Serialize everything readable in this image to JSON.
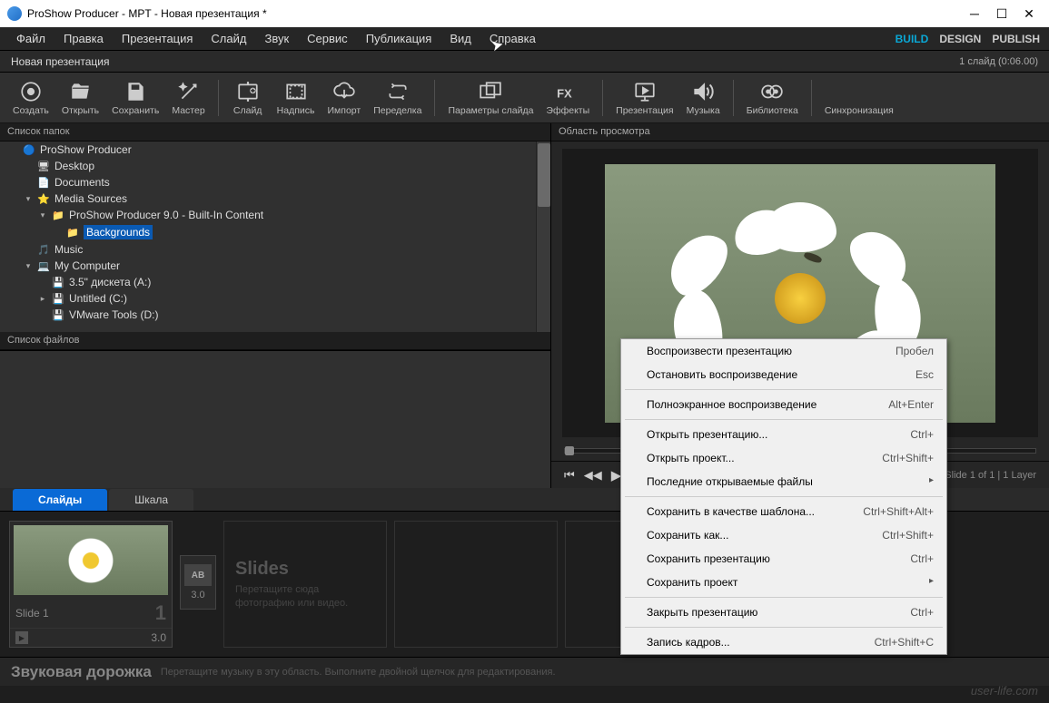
{
  "window": {
    "title": "ProShow Producer - MPT - Новая презентация *"
  },
  "menu": [
    "Файл",
    "Правка",
    "Презентация",
    "Слайд",
    "Звук",
    "Сервис",
    "Публикация",
    "Вид",
    "Справка"
  ],
  "modes": {
    "build": "BUILD",
    "design": "DESIGN",
    "publish": "PUBLISH"
  },
  "subtitle": {
    "left": "Новая презентация",
    "right": "1 слайд (0:06.00)"
  },
  "toolbar": [
    {
      "id": "create",
      "label": "Создать"
    },
    {
      "id": "open",
      "label": "Открыть"
    },
    {
      "id": "save",
      "label": "Сохранить"
    },
    {
      "id": "wizard",
      "label": "Мастер"
    },
    {
      "sep": true
    },
    {
      "id": "slide",
      "label": "Слайд"
    },
    {
      "id": "caption",
      "label": "Надпись"
    },
    {
      "id": "import",
      "label": "Импорт"
    },
    {
      "id": "remix",
      "label": "Переделка"
    },
    {
      "sep": true
    },
    {
      "id": "slide-params",
      "label": "Параметры слайда"
    },
    {
      "id": "effects",
      "label": "Эффекты"
    },
    {
      "sep": true
    },
    {
      "id": "presentation",
      "label": "Презентация"
    },
    {
      "id": "music",
      "label": "Музыка"
    },
    {
      "sep": true
    },
    {
      "id": "library",
      "label": "Библиотека"
    },
    {
      "sep": true
    },
    {
      "id": "sync",
      "label": "Синхронизация"
    }
  ],
  "panes": {
    "folders": "Список папок",
    "files": "Список файлов",
    "preview": "Область просмотра"
  },
  "tree": [
    {
      "indent": 0,
      "icon": "app",
      "label": "ProShow Producer",
      "expand": ""
    },
    {
      "indent": 1,
      "icon": "desktop",
      "label": "Desktop",
      "expand": ""
    },
    {
      "indent": 1,
      "icon": "doc",
      "label": "Documents",
      "expand": ""
    },
    {
      "indent": 1,
      "icon": "star",
      "label": "Media Sources",
      "expand": "▾"
    },
    {
      "indent": 2,
      "icon": "folder",
      "label": "ProShow Producer 9.0 - Built-In Content",
      "expand": "▾"
    },
    {
      "indent": 3,
      "icon": "folder",
      "label": "Backgrounds",
      "expand": "",
      "selected": true
    },
    {
      "indent": 1,
      "icon": "music",
      "label": "Music",
      "expand": ""
    },
    {
      "indent": 1,
      "icon": "pc",
      "label": "My Computer",
      "expand": "▾"
    },
    {
      "indent": 2,
      "icon": "drive",
      "label": "3.5\" дискета (A:)",
      "expand": ""
    },
    {
      "indent": 2,
      "icon": "drive",
      "label": "Untitled (C:)",
      "expand": "▸"
    },
    {
      "indent": 2,
      "icon": "drive",
      "label": "VMware Tools (D:)",
      "expand": ""
    }
  ],
  "transport": {
    "info": "Slide 1 of 1  |  1 Layer"
  },
  "tabs": {
    "slides": "Слайды",
    "scale": "Шкала"
  },
  "slide": {
    "name": "Slide 1",
    "num": "1",
    "dur": "3.0",
    "trans": "AB",
    "transDur": "3.0"
  },
  "drop": {
    "title": "Slides",
    "text1": "Перетащите сюда",
    "text2": "фотографию или видео."
  },
  "sound": {
    "title": "Звуковая дорожка",
    "hint": "Перетащите музыку в эту область. Выполните двойной щелчок для редактирования."
  },
  "ctx": [
    {
      "label": "Воспроизвести презентацию",
      "key": "Пробел"
    },
    {
      "label": "Остановить воспроизведение",
      "key": "Esc"
    },
    {
      "sep": true
    },
    {
      "label": "Полноэкранное воспроизведение",
      "key": "Alt+Enter"
    },
    {
      "sep": true
    },
    {
      "label": "Открыть презентацию...",
      "key": "Ctrl+"
    },
    {
      "label": "Открыть проект...",
      "key": "Ctrl+Shift+"
    },
    {
      "label": "Последние открываемые файлы",
      "arrow": true
    },
    {
      "sep": true
    },
    {
      "label": "Сохранить в качестве шаблона...",
      "key": "Ctrl+Shift+Alt+"
    },
    {
      "label": "Сохранить как...",
      "key": "Ctrl+Shift+"
    },
    {
      "label": "Сохранить презентацию",
      "key": "Ctrl+"
    },
    {
      "label": "Сохранить проект",
      "arrow": true
    },
    {
      "sep": true
    },
    {
      "label": "Закрыть презентацию",
      "key": "Ctrl+"
    },
    {
      "sep": true
    },
    {
      "label": "Запись кадров...",
      "key": "Ctrl+Shift+C"
    }
  ],
  "watermark": "user-life.com"
}
